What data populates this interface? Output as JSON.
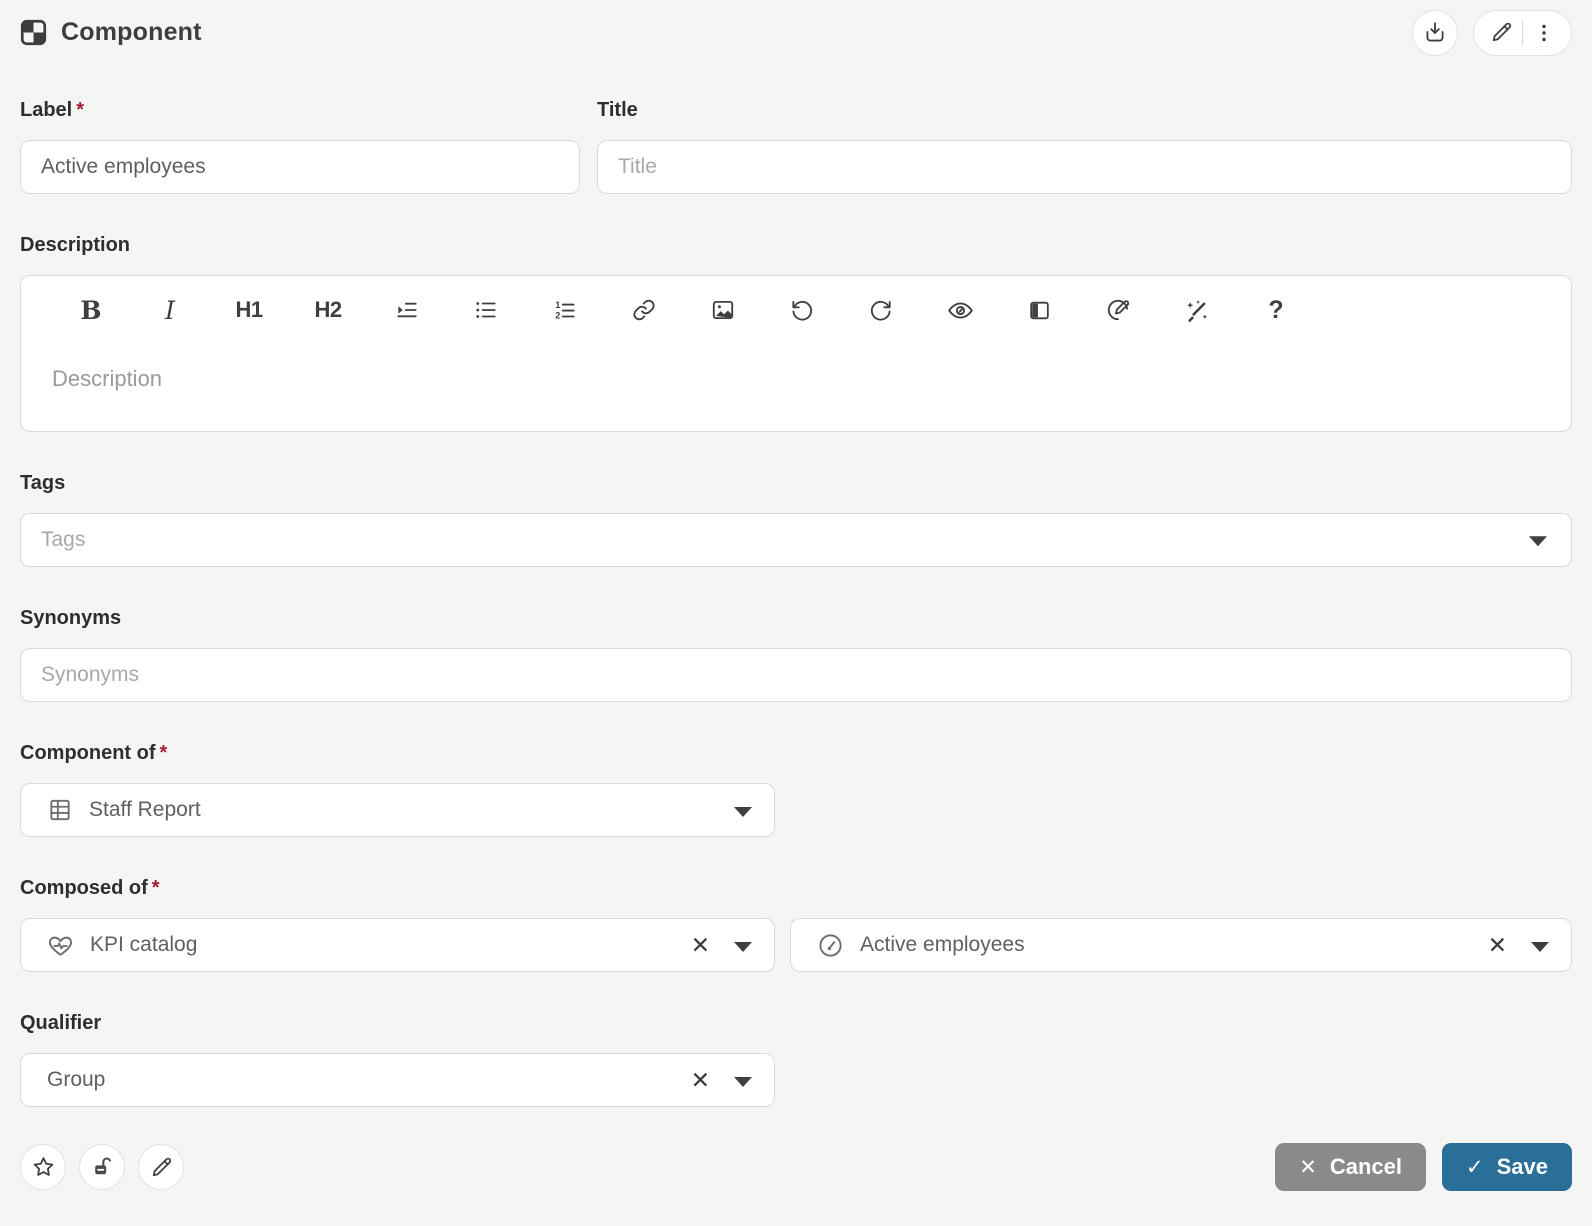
{
  "header": {
    "title": "Component"
  },
  "required_marker": "*",
  "form": {
    "label_field": {
      "label": "Label",
      "value": "Active employees"
    },
    "title_field": {
      "label": "Title",
      "placeholder": "Title"
    },
    "description_field": {
      "label": "Description",
      "placeholder": "Description",
      "toolbar_text": {
        "bold": "B",
        "italic": "I",
        "h1": "H1",
        "h2": "H2",
        "help": "?"
      }
    },
    "tags_field": {
      "label": "Tags",
      "placeholder": "Tags"
    },
    "synonyms_field": {
      "label": "Synonyms",
      "placeholder": "Synonyms"
    },
    "component_of_field": {
      "label": "Component of",
      "value": "Staff Report"
    },
    "composed_of_field": {
      "label": "Composed of",
      "items": [
        {
          "value": "KPI catalog"
        },
        {
          "value": "Active employees"
        }
      ]
    },
    "qualifier_field": {
      "label": "Qualifier",
      "value": "Group"
    }
  },
  "icons": {
    "clear": "✕"
  },
  "footer": {
    "cancel_label": "Cancel",
    "cancel_glyph": "✕",
    "save_label": "Save",
    "save_glyph": "✓"
  },
  "colors": {
    "save_button": "#2a6f97",
    "cancel_button": "#8a8a8a",
    "required_asterisk": "#a51c30",
    "icon": "#3f3f3f",
    "background": "#f5f5f4"
  }
}
